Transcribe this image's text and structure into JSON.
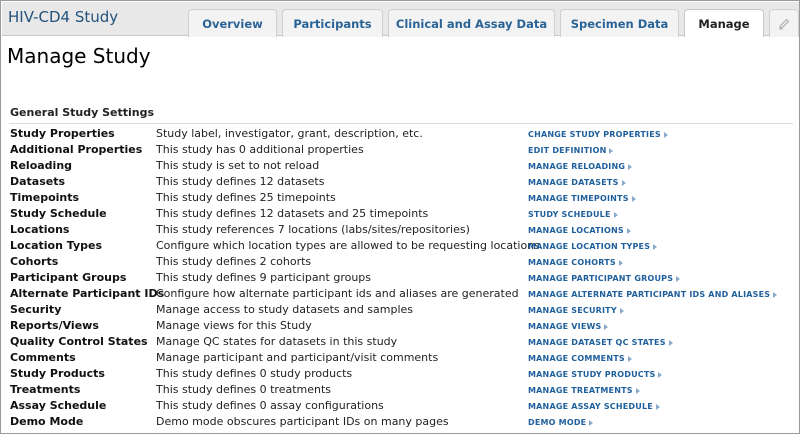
{
  "header": {
    "study_title": "HIV-CD4 Study",
    "tabs": [
      {
        "label": "Overview"
      },
      {
        "label": "Participants"
      },
      {
        "label": "Clinical and Assay Data"
      },
      {
        "label": "Specimen Data"
      },
      {
        "label": "Manage",
        "active": true
      }
    ],
    "edit_icon": "pencil-icon"
  },
  "page": {
    "title": "Manage Study",
    "section_title": "General Study Settings"
  },
  "settings": [
    {
      "label": "Study Properties",
      "description": "Study label, investigator, grant, description, etc.",
      "link": "CHANGE STUDY PROPERTIES"
    },
    {
      "label": "Additional Properties",
      "description": "This study has 0 additional properties",
      "link": "EDIT DEFINITION"
    },
    {
      "label": "Reloading",
      "description": "This study is set to not reload",
      "link": "MANAGE RELOADING"
    },
    {
      "label": "Datasets",
      "description": "This study defines 12 datasets",
      "link": "MANAGE DATASETS"
    },
    {
      "label": "Timepoints",
      "description": "This study defines 25 timepoints",
      "link": "MANAGE TIMEPOINTS"
    },
    {
      "label": "Study Schedule",
      "description": "This study defines 12 datasets and 25 timepoints",
      "link": "STUDY SCHEDULE"
    },
    {
      "label": "Locations",
      "description": "This study references 7 locations (labs/sites/repositories)",
      "link": "MANAGE LOCATIONS"
    },
    {
      "label": "Location Types",
      "description": "Configure which location types are allowed to be requesting locations",
      "link": "MANAGE LOCATION TYPES"
    },
    {
      "label": "Cohorts",
      "description": "This study defines 2 cohorts",
      "link": "MANAGE COHORTS"
    },
    {
      "label": "Participant Groups",
      "description": "This study defines 9 participant groups",
      "link": "MANAGE PARTICIPANT GROUPS"
    },
    {
      "label": "Alternate Participant IDs",
      "description": "Configure how alternate participant ids and aliases are generated",
      "link": "MANAGE ALTERNATE PARTICIPANT IDS AND ALIASES"
    },
    {
      "label": "Security",
      "description": "Manage access to study datasets and samples",
      "link": "MANAGE SECURITY"
    },
    {
      "label": "Reports/Views",
      "description": "Manage views for this Study",
      "link": "MANAGE VIEWS"
    },
    {
      "label": "Quality Control States",
      "description": "Manage QC states for datasets in this study",
      "link": "MANAGE DATASET QC STATES"
    },
    {
      "label": "Comments",
      "description": "Manage participant and participant/visit comments",
      "link": "MANAGE COMMENTS"
    },
    {
      "label": "Study Products",
      "description": "This study defines 0 study products",
      "link": "MANAGE STUDY PRODUCTS"
    },
    {
      "label": "Treatments",
      "description": "This study defines 0 treatments",
      "link": "MANAGE TREATMENTS"
    },
    {
      "label": "Assay Schedule",
      "description": "This study defines 0 assay configurations",
      "link": "MANAGE ASSAY SCHEDULE"
    },
    {
      "label": "Demo Mode",
      "description": "Demo mode obscures participant IDs on many pages",
      "link": "DEMO MODE"
    }
  ]
}
